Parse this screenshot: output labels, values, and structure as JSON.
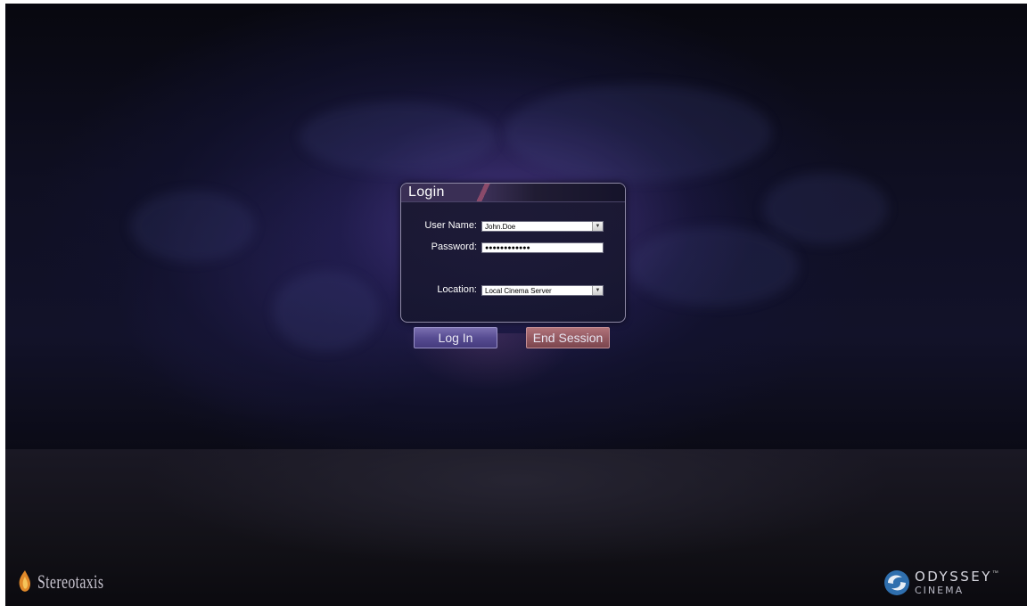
{
  "login": {
    "title": "Login",
    "username_label": "User Name:",
    "username_value": "John.Doe",
    "password_label": "Password:",
    "password_value": "●●●●●●●●●●●●",
    "location_label": "Location:",
    "location_value": "Local Cinema Server"
  },
  "buttons": {
    "login_label": "Log In",
    "end_session_label": "End Session"
  },
  "branding": {
    "left_logo_text": "Stereotaxis",
    "right_logo_word1": "ODYSSEY",
    "right_logo_word2": "CINEMA",
    "right_logo_mark": "™"
  },
  "colors": {
    "login_button": "#574c92",
    "end_session_button": "#955a62",
    "background": "#121229"
  },
  "icons": {
    "left_logo": "flame-icon",
    "right_logo": "odyssey-swirl-icon",
    "dropdown": "chevron-down-icon"
  }
}
